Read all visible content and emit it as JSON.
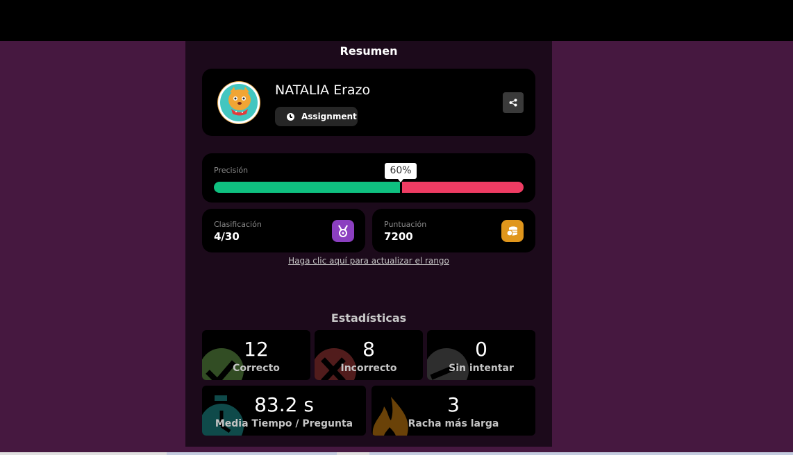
{
  "summary": {
    "title": "Resumen"
  },
  "player": {
    "name": "NATALIA Erazo",
    "mode_label": "Assignment"
  },
  "accuracy": {
    "label": "Precisión",
    "percent_text": "60%",
    "value": 0.6
  },
  "rank": {
    "label": "Clasificación",
    "value": "4/30"
  },
  "score": {
    "label": "Puntuación",
    "value": "7200"
  },
  "update_link": "Haga clic aquí para actualizar el rango",
  "stats": {
    "title": "Estadísticas",
    "correct": {
      "value": "12",
      "label": "Correcto"
    },
    "incorrect": {
      "value": "8",
      "label": "Incorrecto"
    },
    "unattempted": {
      "value": "0",
      "label": "Sin intentar"
    },
    "avg_time": {
      "value": "83.2 s",
      "label": "Media Tiempo / Pregunta"
    },
    "streak": {
      "value": "3",
      "label": "Racha más larga"
    }
  },
  "colors": {
    "background": "#461840",
    "panel": "#1c0a1b",
    "correct": "#0fc080",
    "incorrect": "#ef3c63",
    "rank_badge": "#8b3fc0",
    "score_badge": "#e0961c"
  },
  "icons": {
    "share": "share-icon",
    "clock": "clock-icon",
    "medal": "medal-icon",
    "coins": "coins-icon",
    "check": "check-icon",
    "cross": "cross-icon",
    "dash": "dash-icon",
    "stopwatch": "stopwatch-icon",
    "flame": "flame-icon"
  }
}
